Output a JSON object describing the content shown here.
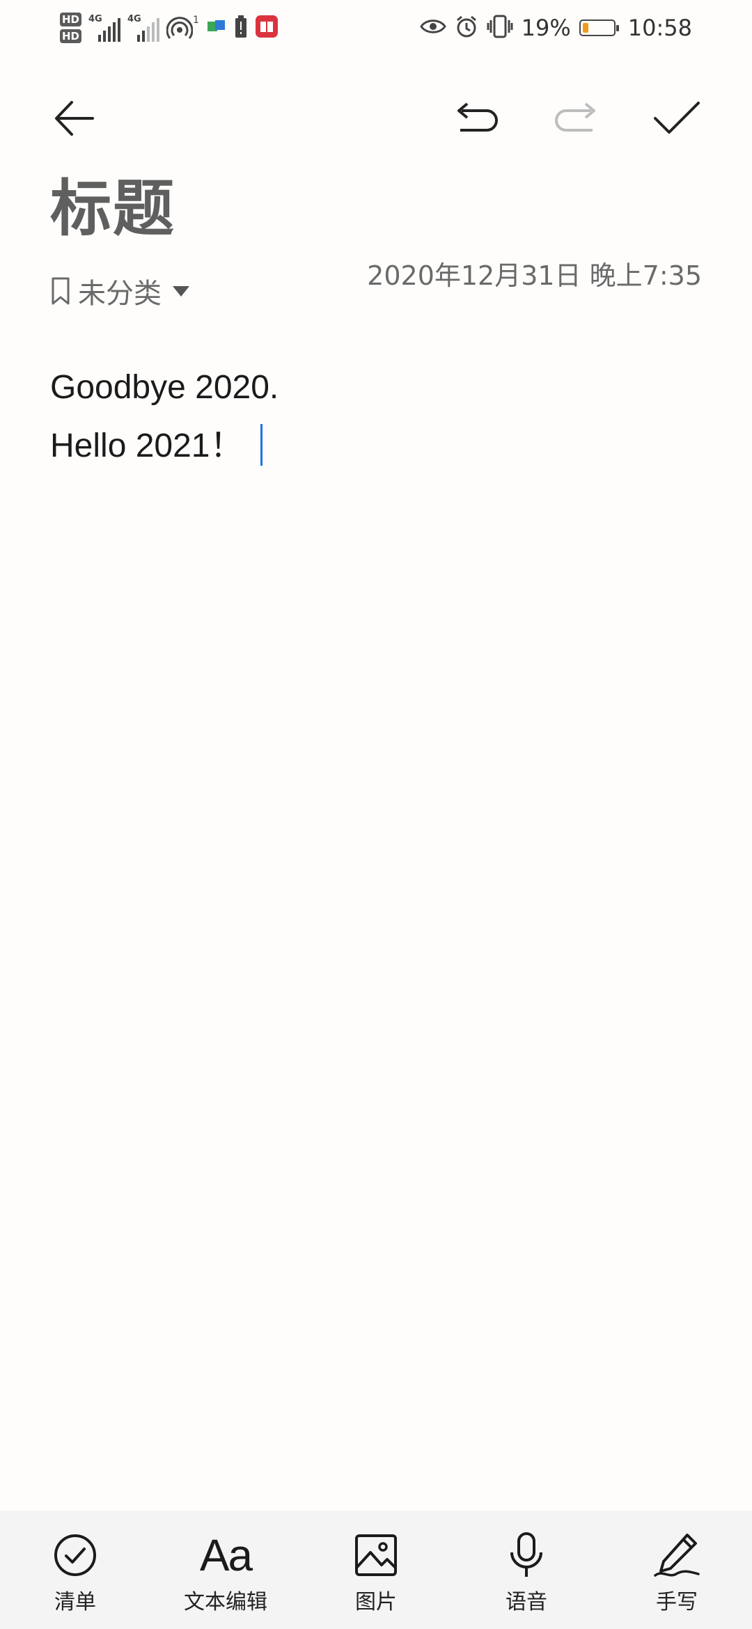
{
  "status_bar": {
    "hd1": "HD",
    "hd2": "HD",
    "net1": "4G",
    "net2": "4G",
    "hotspot_count": "1",
    "battery_percent": "19%",
    "battery_level": 0.19,
    "time": "10:58"
  },
  "editor": {
    "title": "标题",
    "category": "未分类",
    "date": "2020年12月31日 晚上7:35",
    "lines": [
      "Goodbye 2020.",
      "Hello 2021！"
    ]
  },
  "bottom_toolbar": {
    "items": [
      {
        "label": "清单",
        "icon": "checklist-icon"
      },
      {
        "label": "文本编辑",
        "icon": "text-format-icon",
        "glyph": "Aa"
      },
      {
        "label": "图片",
        "icon": "image-icon"
      },
      {
        "label": "语音",
        "icon": "microphone-icon"
      },
      {
        "label": "手写",
        "icon": "handwriting-icon"
      }
    ]
  },
  "colors": {
    "background": "#fefdfb",
    "cursor": "#1a73e8",
    "battery_fill": "#f29a1b",
    "bottom_bar": "#f4f4f4"
  }
}
